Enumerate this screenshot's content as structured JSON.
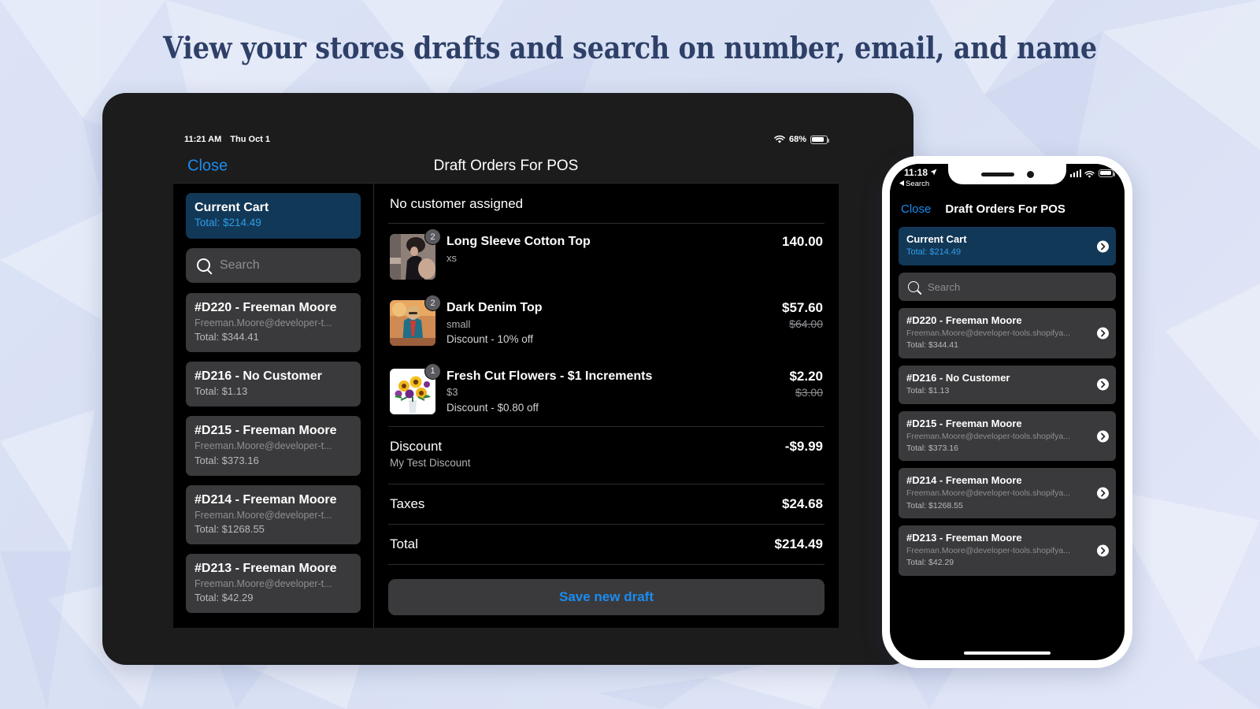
{
  "headline": "View your stores drafts and search on number, email, and name",
  "theme": {
    "background": "#dbe2f5",
    "headline_color": "#2e4068",
    "accent_blue": "#1b8cf0",
    "selected_cell": "#123857",
    "cell_bg": "#3a3a3c",
    "screen_bg": "#000000"
  },
  "tablet": {
    "status_bar": {
      "time": "11:21 AM",
      "date": "Thu Oct 1",
      "wifi_icon": "wifi-icon",
      "battery_percent": "68%",
      "battery_icon": "battery-icon"
    },
    "nav": {
      "close_label": "Close",
      "title": "Draft Orders For POS"
    },
    "sidebar": {
      "search_placeholder": "Search",
      "search_icon": "search-icon",
      "current_cart": {
        "title": "Current Cart",
        "total": "Total: $214.49"
      },
      "drafts": [
        {
          "title": "#D220 - Freeman Moore",
          "email": "Freeman.Moore@developer-t...",
          "total": "Total: $344.41"
        },
        {
          "title": "#D216 - No Customer",
          "email": "",
          "total": "Total: $1.13"
        },
        {
          "title": "#D215 - Freeman Moore",
          "email": "Freeman.Moore@developer-t...",
          "total": "Total: $373.16"
        },
        {
          "title": "#D214 - Freeman Moore",
          "email": "Freeman.Moore@developer-t...",
          "total": "Total: $1268.55"
        },
        {
          "title": "#D213 - Freeman Moore",
          "email": "Freeman.Moore@developer-t...",
          "total": "Total: $42.29"
        }
      ]
    },
    "main": {
      "customer_row": "No customer assigned",
      "line_items": [
        {
          "qty": "2",
          "name": "Long Sleeve Cotton Top",
          "variant": "xs",
          "discount": "",
          "price": "140.00",
          "price_was": "",
          "thumb": "woman-black-top-photo"
        },
        {
          "qty": "2",
          "name": "Dark Denim Top",
          "variant": "small",
          "discount": "Discount - 10% off",
          "price": "$57.60",
          "price_was": "$64.00",
          "thumb": "woman-denim-jacket-photo"
        },
        {
          "qty": "1",
          "name": "Fresh Cut Flowers - $1 Increments",
          "variant": "$3",
          "discount": "Discount - $0.80 off",
          "price": "$2.20",
          "price_was": "$3.00",
          "thumb": "sunflower-bouquet-photo"
        }
      ],
      "summary": [
        {
          "label": "Discount",
          "note": "My Test Discount",
          "value": "-$9.99"
        },
        {
          "label": "Taxes",
          "note": "",
          "value": "$24.68"
        },
        {
          "label": "Total",
          "note": "",
          "value": "$214.49"
        }
      ],
      "save_button": "Save new draft"
    }
  },
  "phone": {
    "status_bar": {
      "time": "11:18",
      "location_icon": "location-arrow-icon",
      "back_label": "Search",
      "back_icon": "back-triangle-icon",
      "signal_icon": "cellular-bars-icon",
      "wifi_icon": "wifi-icon",
      "battery_icon": "battery-icon"
    },
    "nav": {
      "close_label": "Close",
      "title": "Draft Orders For POS"
    },
    "search_placeholder": "Search",
    "search_icon": "search-icon",
    "current_cart": {
      "title": "Current Cart",
      "total": "Total: $214.49"
    },
    "drafts": [
      {
        "title": "#D220 - Freeman Moore",
        "email": "Freeman.Moore@developer-tools.shopifya...",
        "total": "Total: $344.41"
      },
      {
        "title": "#D216 - No Customer",
        "email": "",
        "total": "Total: $1.13"
      },
      {
        "title": "#D215 - Freeman Moore",
        "email": "Freeman.Moore@developer-tools.shopifya...",
        "total": "Total: $373.16"
      },
      {
        "title": "#D214 - Freeman Moore",
        "email": "Freeman.Moore@developer-tools.shopifya...",
        "total": "Total: $1268.55"
      },
      {
        "title": "#D213 - Freeman Moore",
        "email": "Freeman.Moore@developer-tools.shopifya...",
        "total": "Total: $42.29"
      }
    ]
  }
}
